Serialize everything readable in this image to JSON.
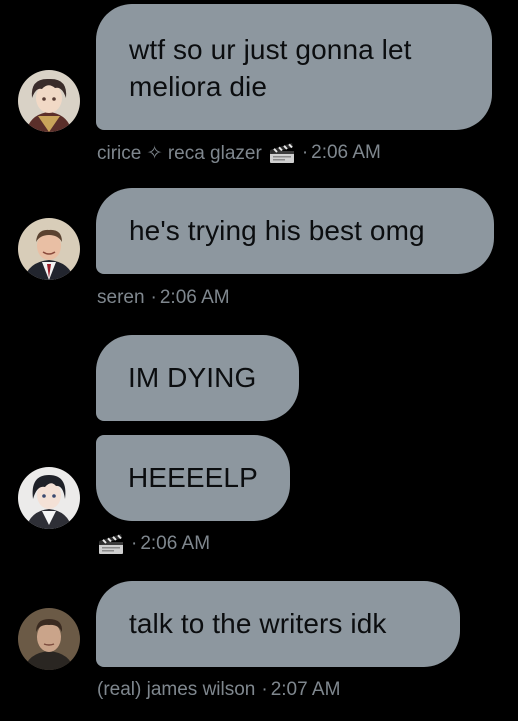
{
  "colors": {
    "background": "#000000",
    "bubble": "#8d979f",
    "bubble_text": "#0b0d0f",
    "meta_text": "#7f878e"
  },
  "messages": [
    {
      "text": "wtf so ur just gonna let meliora die",
      "sender": "cirice ✧ reca glazer",
      "sender_icon": "clapperboard-icon",
      "time": "2:06 AM"
    },
    {
      "text": "he's trying his best omg",
      "sender": "seren",
      "time": "2:06 AM"
    },
    {
      "text": "IM DYING",
      "sender": "",
      "time": ""
    },
    {
      "text": "HEEEELP",
      "sender": "",
      "sender_icon": "clapperboard-icon",
      "time": "2:06 AM"
    },
    {
      "text": "talk to the writers idk",
      "sender": "(real) james wilson",
      "time": "2:07 AM"
    }
  ],
  "separator": "·"
}
